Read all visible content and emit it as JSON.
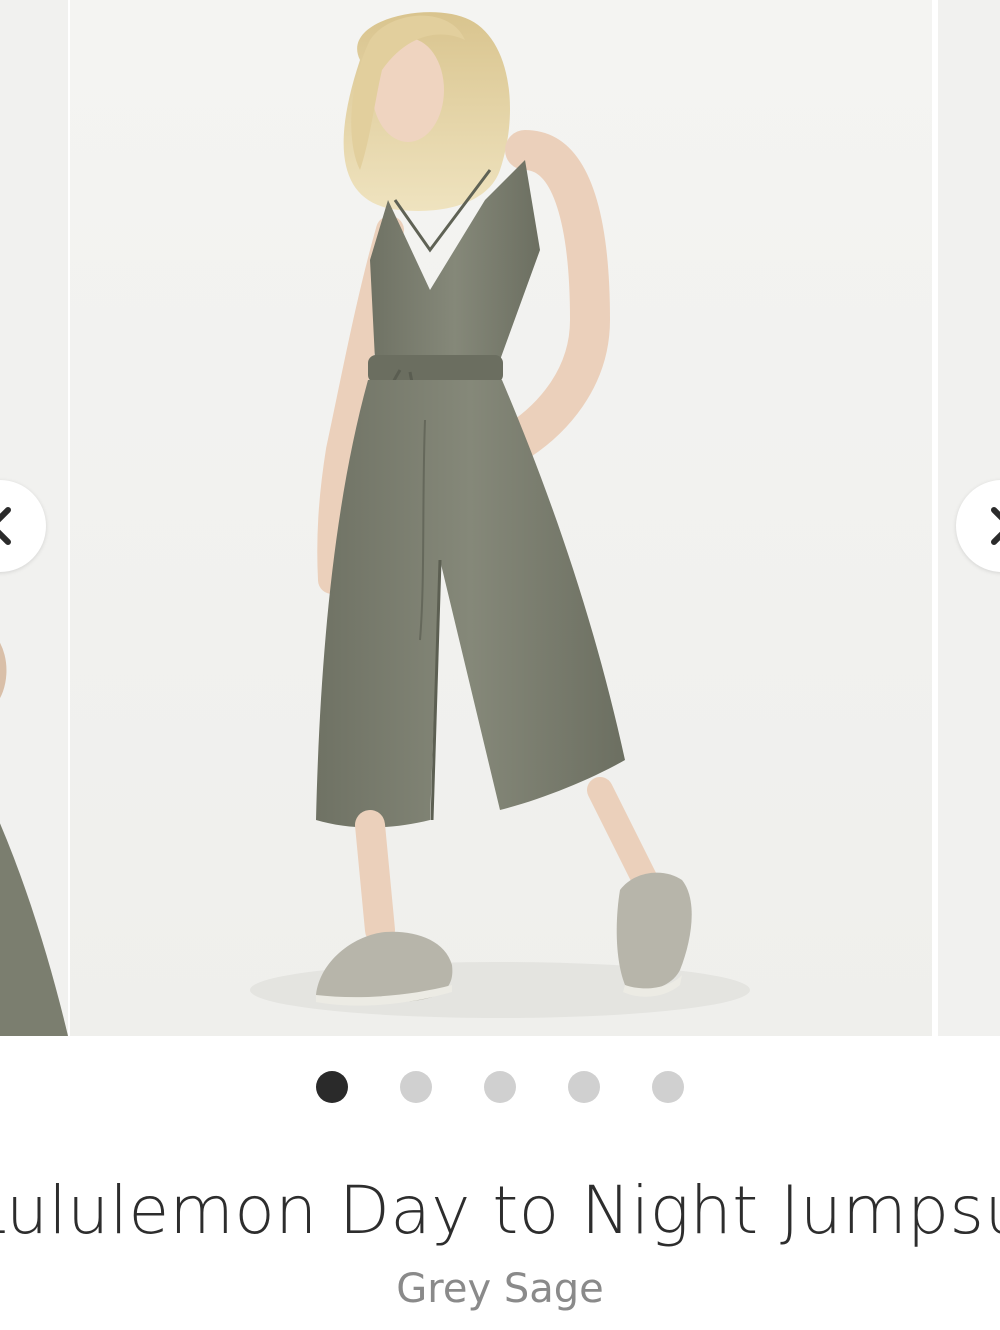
{
  "carousel": {
    "slides": [
      {
        "description_icon": "product-photo",
        "state": "previous"
      },
      {
        "description_icon": "product-photo",
        "state": "current"
      },
      {
        "description_icon": "product-photo",
        "state": "next"
      }
    ],
    "prev_icon": "chevron-left-icon",
    "next_icon": "chevron-right-icon",
    "dots_total": 5,
    "active_dot": 1
  },
  "product": {
    "title": "Lululemon Day to Night Jumpsuit",
    "color": "Grey Sage"
  },
  "colors": {
    "garment": "#7b7e6f",
    "dot_active": "#2a2a2a",
    "dot_inactive": "#d0d0d0",
    "title": "#2d2d2d",
    "subtitle": "#8a8a8a"
  }
}
